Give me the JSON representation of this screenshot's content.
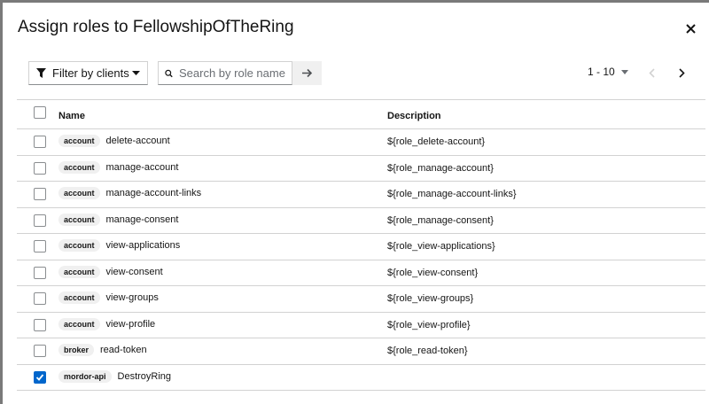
{
  "modal": {
    "title": "Assign roles to FellowshipOfTheRing"
  },
  "toolbar": {
    "filter_label": "Filter by clients",
    "search_placeholder": "Search by role name",
    "pagination_range": "1 - 10"
  },
  "table": {
    "columns": [
      "Name",
      "Description"
    ],
    "rows": [
      {
        "client": "account",
        "role": "delete-account",
        "description": "${role_delete-account}",
        "checked": false
      },
      {
        "client": "account",
        "role": "manage-account",
        "description": "${role_manage-account}",
        "checked": false
      },
      {
        "client": "account",
        "role": "manage-account-links",
        "description": "${role_manage-account-links}",
        "checked": false
      },
      {
        "client": "account",
        "role": "manage-consent",
        "description": "${role_manage-consent}",
        "checked": false
      },
      {
        "client": "account",
        "role": "view-applications",
        "description": "${role_view-applications}",
        "checked": false
      },
      {
        "client": "account",
        "role": "view-consent",
        "description": "${role_view-consent}",
        "checked": false
      },
      {
        "client": "account",
        "role": "view-groups",
        "description": "${role_view-groups}",
        "checked": false
      },
      {
        "client": "account",
        "role": "view-profile",
        "description": "${role_view-profile}",
        "checked": false
      },
      {
        "client": "broker",
        "role": "read-token",
        "description": "${role_read-token}",
        "checked": false
      },
      {
        "client": "mordor-api",
        "role": "DestroyRing",
        "description": "",
        "checked": true
      }
    ]
  },
  "colors": {
    "accent": "#0066cc",
    "border": "#d2d2d2",
    "badge_bg": "#f0f0f0"
  },
  "icons": {
    "close": "close-icon",
    "filter": "filter-icon",
    "caret": "caret-down-icon",
    "search": "search-icon",
    "go": "arrow-right-icon",
    "prev": "chevron-left-icon",
    "next": "chevron-right-icon"
  }
}
